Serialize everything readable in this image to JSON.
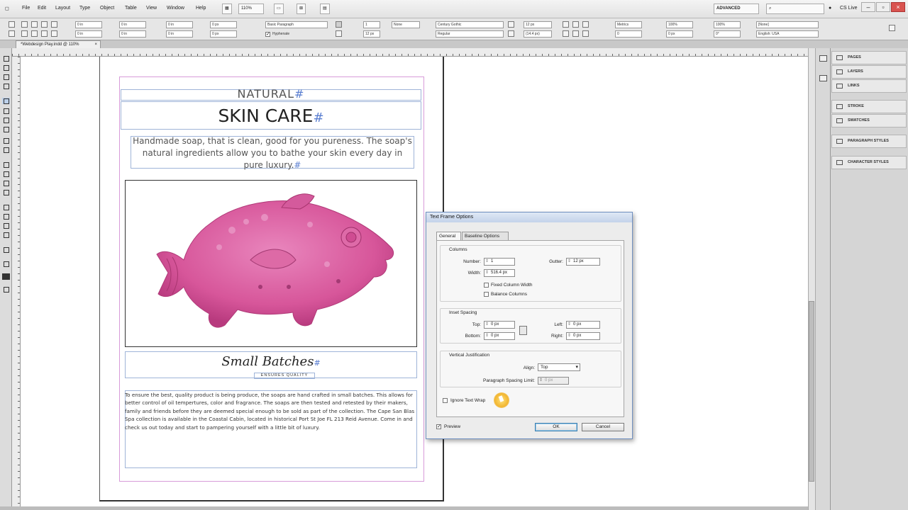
{
  "menubar": {
    "items": [
      "File",
      "Edit",
      "Layout",
      "Type",
      "Object",
      "Table",
      "View",
      "Window",
      "Help"
    ],
    "zoom": "110%",
    "workspace": "ADVANCED",
    "cs_live": "CS Live"
  },
  "controlbar": {
    "paragraph_style": "Basic Paragraph",
    "hyphenate": "Hyphenate",
    "none_swatch": "None",
    "font_family": "Century Gothic",
    "font_style": "Regular",
    "font_size": "12 px",
    "leading": "(14.4 px)",
    "tracking_unit": "Metrics",
    "scale_h": "100%",
    "scale_v": "100%",
    "baseline_shift": "0 px",
    "skew": "0°",
    "char_style": "[None]",
    "language": "English: USA",
    "indent1": "0 in",
    "indent2": "0 in",
    "indent3": "0 in",
    "indent4": "0 in",
    "spacing1": "0 px",
    "spacing2": "0 px",
    "columns": "1",
    "col_width": "12 px",
    "tracking": "0",
    "kerning": "0"
  },
  "document": {
    "tab": "*Webdesign Play.indd @ 110%"
  },
  "page": {
    "natural": "NATURAL",
    "skin_care": "SKIN CARE",
    "pilcrow": "#",
    "intro": "Handmade soap, that is clean, good for you pureness. The soap's natural ingredients allow you to bathe your skin every day in pure luxury.",
    "small_batches": "Small Batches",
    "ensures_quality": "ENSURES QUALITY",
    "body": "To ensure the best, quality product is being produce, the soaps are hand crafted in small batches. This allows for better control of oil tempertures, color and fragrance. The soaps are then tested and retested by their makers, family and friends before they are deemed special enough to be sold as part of the collection. The Cape San Blas Spa collection is available in the Coastal Cabin, located in historical Port St Joe FL 213 Reid Avenue. Come in and check us out today and start to pampering yourself with a little bit of luxury."
  },
  "panels": {
    "items": [
      "PAGES",
      "LAYERS",
      "LINKS",
      "STROKE",
      "SWATCHES",
      "PARAGRAPH STYLES",
      "CHARACTER STYLES"
    ]
  },
  "dialog": {
    "title": "Text Frame Options",
    "tabs": [
      "General",
      "Baseline Options"
    ],
    "columns_title": "Columns",
    "number_label": "Number:",
    "number_value": "1",
    "gutter_label": "Gutter:",
    "gutter_value": "12 px",
    "width_label": "Width:",
    "width_value": "516.4 px",
    "fixed_column_width": "Fixed Column Width",
    "balance_columns": "Balance Columns",
    "inset_title": "Inset Spacing",
    "top_label": "Top:",
    "top_value": "0 px",
    "bottom_label": "Bottom:",
    "bottom_value": "0 px",
    "left_label": "Left:",
    "left_value": "0 px",
    "right_label": "Right:",
    "right_value": "0 px",
    "vj_title": "Vertical Justification",
    "align_label": "Align:",
    "align_value": "Top",
    "psl_label": "Paragraph Spacing Limit:",
    "psl_value": "0 px",
    "ignore_wrap": "Ignore Text Wrap",
    "preview": "Preview",
    "ok": "OK",
    "cancel": "Cancel"
  },
  "colors": {
    "accent": "#5b7fd1",
    "margin_guide": "#d79bd9",
    "soap": "#d9579b"
  }
}
